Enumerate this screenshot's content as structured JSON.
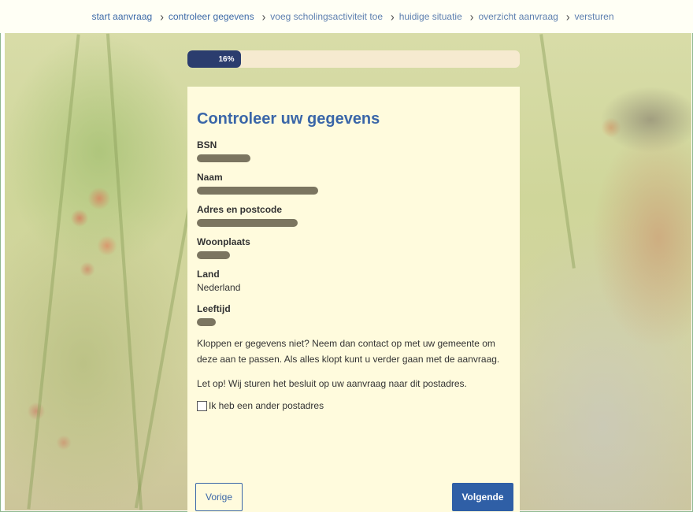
{
  "breadcrumb": {
    "items": [
      {
        "label": "start aanvraag"
      },
      {
        "label": "controleer gegevens"
      },
      {
        "label": "voeg scholingsactiviteit toe"
      },
      {
        "label": "huidige situatie"
      },
      {
        "label": "overzicht aanvraag"
      },
      {
        "label": "versturen"
      }
    ],
    "separator": "›"
  },
  "progress": {
    "percent": 16,
    "label": "16%"
  },
  "card": {
    "title": "Controleer uw gegevens",
    "fields": [
      {
        "label": "BSN",
        "value": null,
        "redacted": true
      },
      {
        "label": "Naam",
        "value": null,
        "redacted": true
      },
      {
        "label": "Adres en postcode",
        "value": null,
        "redacted": true
      },
      {
        "label": "Woonplaats",
        "value": null,
        "redacted": true
      },
      {
        "label": "Land",
        "value": "Nederland",
        "redacted": false
      },
      {
        "label": "Leeftijd",
        "value": null,
        "redacted": true
      }
    ],
    "note": "Kloppen er gegevens niet? Neem dan contact op met uw gemeente om deze aan te passen. Als alles klopt kunt u verder gaan met de aanvraag.",
    "note2": "Let op! Wij sturen het besluit op uw aanvraag naar dit postadres.",
    "checkbox_label": "Ik heb een ander postadres",
    "checkbox_checked": false
  },
  "buttons": {
    "prev": "Vorige",
    "next": "Volgende"
  },
  "colors": {
    "accent": "#3a66a8",
    "progress": "#2b3d6e",
    "card_bg": "#fffbdd"
  }
}
